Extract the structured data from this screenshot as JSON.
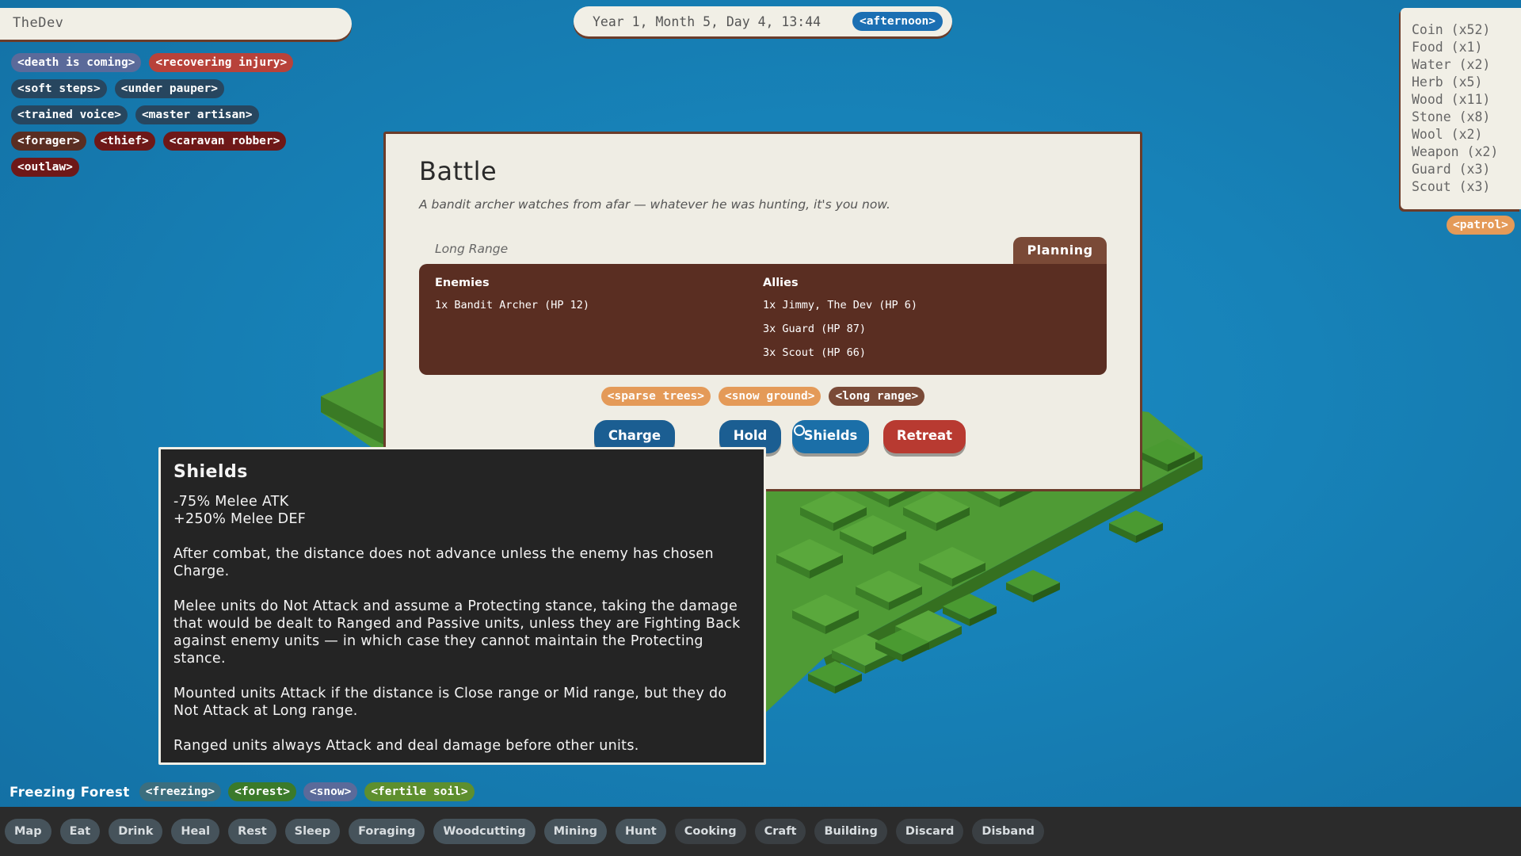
{
  "player": {
    "name": "TheDev"
  },
  "traits": [
    [
      {
        "label": "<death is coming>",
        "color": "#5b6a9a"
      },
      {
        "label": "<recovering injury>",
        "color": "#b8423a"
      }
    ],
    [
      {
        "label": "<soft steps>",
        "color": "#27465f"
      },
      {
        "label": "<under pauper>",
        "color": "#27465f"
      }
    ],
    [
      {
        "label": "<trained voice>",
        "color": "#27465f"
      },
      {
        "label": "<master artisan>",
        "color": "#27465f"
      }
    ],
    [
      {
        "label": "<forager>",
        "color": "#5a2e22"
      },
      {
        "label": "<thief>",
        "color": "#6e1818"
      },
      {
        "label": "<caravan robber>",
        "color": "#6e1818"
      }
    ],
    [
      {
        "label": "<outlaw>",
        "color": "#6e1818"
      }
    ]
  ],
  "datetime": {
    "text": "Year 1, Month 5, Day 4, 13:44",
    "period": "<afternoon>"
  },
  "inventory": [
    "Coin (x52)",
    "Food (x1)",
    "Water (x2)",
    "Herb (x5)",
    "Wood (x11)",
    "Stone (x8)",
    "Wool (x2)",
    "Weapon (x2)",
    "Guard (x3)",
    "Scout (x3)"
  ],
  "status_tag": "<patrol>",
  "battle": {
    "title": "Battle",
    "subtitle": "A bandit archer watches from afar — whatever he was hunting, it's you now.",
    "range": "Long Range",
    "phase": "Planning",
    "enemies_header": "Enemies",
    "enemies": [
      "1x Bandit Archer (HP 12)"
    ],
    "allies_header": "Allies",
    "allies": [
      "1x Jimmy, The Dev  (HP 6)",
      "3x Guard (HP 87)",
      "3x Scout (HP 66)"
    ],
    "terrain": [
      {
        "label": "<sparse trees>",
        "color": "#e49a58"
      },
      {
        "label": "<snow ground>",
        "color": "#e49a58"
      },
      {
        "label": "<long range>",
        "color": "#7a4a37"
      }
    ],
    "actions": {
      "charge": "Charge",
      "hold": "Hold",
      "shields": "Shields",
      "retreat": "Retreat"
    }
  },
  "tooltip": {
    "title": "Shields",
    "stats": [
      "-75% Melee ATK",
      "+250% Melee DEF"
    ],
    "paragraphs": [
      "After combat, the distance does not advance unless the enemy has chosen Charge.",
      "Melee units do Not Attack and assume a Protecting stance, taking the damage that would be dealt to Ranged and Passive units, unless they are Fighting Back against enemy units — in which case they cannot maintain the Protecting stance.",
      "Mounted units Attack if the distance is Close range or Mid range, but they do Not Attack at Long range.",
      "Ranged units always Attack and deal damage before other units."
    ]
  },
  "location": {
    "name": "Freezing Forest",
    "tags": [
      {
        "label": "<freezing>",
        "color": "#3c6e7e"
      },
      {
        "label": "<forest>",
        "color": "#3b7a2a"
      },
      {
        "label": "<snow>",
        "color": "#5b6a9a"
      },
      {
        "label": "<fertile soil>",
        "color": "#5e8f2e"
      }
    ]
  },
  "bottom_bar": [
    {
      "label": "Map",
      "dark": false
    },
    {
      "label": "Eat",
      "dark": false
    },
    {
      "label": "Drink",
      "dark": false
    },
    {
      "label": "Heal",
      "dark": false
    },
    {
      "label": "Rest",
      "dark": false
    },
    {
      "label": "Sleep",
      "dark": false
    },
    {
      "label": "Foraging",
      "dark": false
    },
    {
      "label": "Woodcutting",
      "dark": false
    },
    {
      "label": "Mining",
      "dark": false
    },
    {
      "label": "Hunt",
      "dark": false
    },
    {
      "label": "Cooking",
      "dark": true
    },
    {
      "label": "Craft",
      "dark": true
    },
    {
      "label": "Building",
      "dark": true
    },
    {
      "label": "Discard",
      "dark": true
    },
    {
      "label": "Disband",
      "dark": true
    }
  ],
  "colors": {
    "panel": "#f1efe6",
    "frame": "#6b3c2a",
    "forces_bg": "#5a2e22",
    "ocean": "#1782b8",
    "grass": "#4e9b34"
  }
}
